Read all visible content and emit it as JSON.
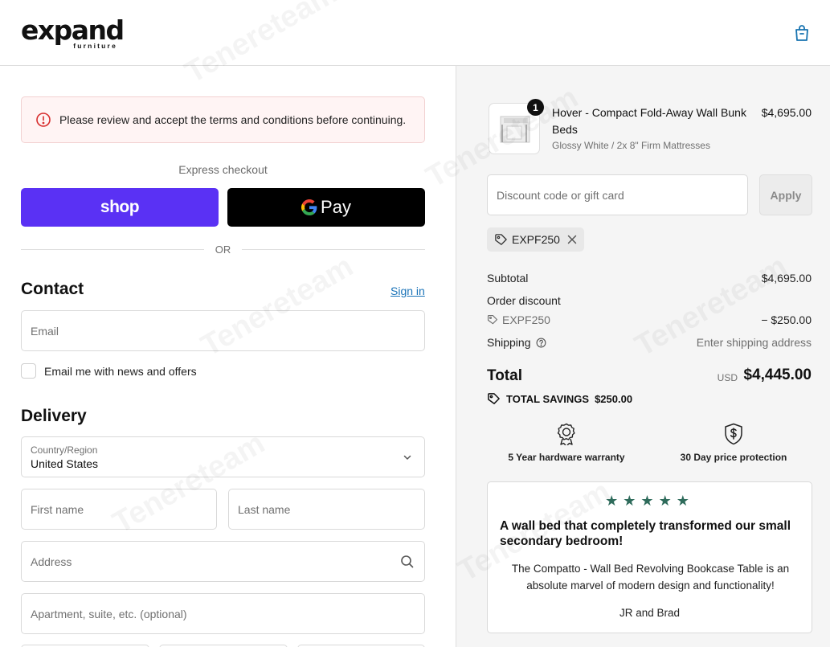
{
  "header": {
    "logo_text": "expand",
    "logo_sub": "furniture",
    "cart_icon": "shopping-bag-icon"
  },
  "alert": {
    "message": "Please review and accept the terms and conditions before continuing.",
    "icon": "alert-circle-icon",
    "color": "#d72c2c"
  },
  "express": {
    "label": "Express checkout",
    "shop_label": "shop",
    "gpay_label": "Pay",
    "or_label": "OR",
    "shop_color": "#5a31f4"
  },
  "contact": {
    "heading": "Contact",
    "signin_label": "Sign in",
    "email_placeholder": "Email",
    "newsletter_label": "Email me with news and offers"
  },
  "delivery": {
    "heading": "Delivery",
    "country_caption": "Country/Region",
    "country_value": "United States",
    "first_name_placeholder": "First name",
    "last_name_placeholder": "Last name",
    "address_placeholder": "Address",
    "apartment_placeholder": "Apartment, suite, etc. (optional)"
  },
  "summary": {
    "product": {
      "quantity": "1",
      "name": "Hover - Compact Fold-Away Wall Bunk Beds",
      "variant": "Glossy White / 2x 8\" Firm Mattresses",
      "price": "$4,695.00"
    },
    "discount_placeholder": "Discount code or gift card",
    "apply_label": "Apply",
    "applied_code": "EXPF250",
    "subtotal_label": "Subtotal",
    "subtotal_value": "$4,695.00",
    "order_discount_label": "Order discount",
    "discount_code": "EXPF250",
    "discount_value": "− $250.00",
    "shipping_label": "Shipping",
    "shipping_value": "Enter shipping address",
    "total_label": "Total",
    "currency": "USD",
    "total_value": "$4,445.00",
    "savings_label": "TOTAL SAVINGS",
    "savings_value": "$250.00"
  },
  "guarantees": [
    {
      "label": "5 Year hardware warranty",
      "icon": "award-ribbon-icon"
    },
    {
      "label": "30 Day price protection",
      "icon": "shield-dollar-icon"
    }
  ],
  "review": {
    "stars": "★★★★★",
    "title": "A wall bed that completely transformed our small secondary bedroom!",
    "body": "The Compatto - Wall Bed Revolving Bookcase Table is an absolute marvel of modern design and functionality!",
    "author": "JR and Brad",
    "star_color": "#2e6b5b"
  },
  "watermark_text": "Tenereteam"
}
